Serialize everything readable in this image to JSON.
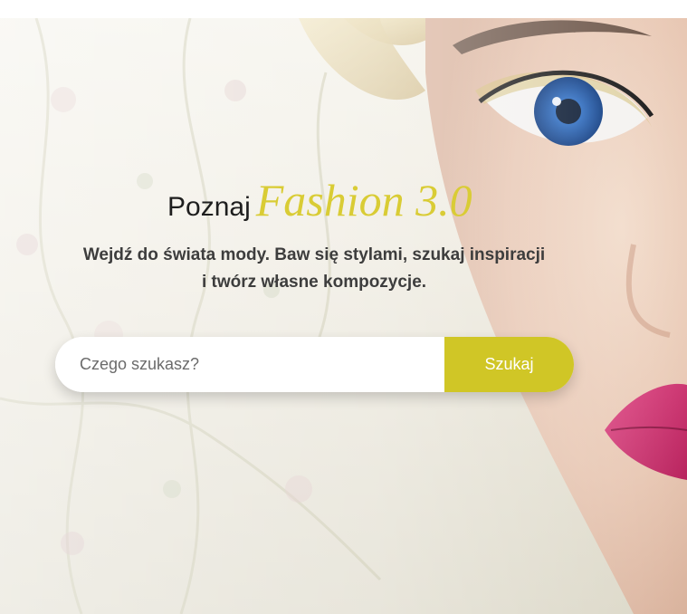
{
  "hero": {
    "headline_plain": "Poznaj",
    "headline_brand": "Fashion 3.0",
    "subtitle_line1": "Wejdź do świata mody. Baw się stylami, szukaj inspiracji",
    "subtitle_line2": "i twórz własne kompozycje."
  },
  "search": {
    "placeholder": "Czego szukasz?",
    "value": "",
    "button_label": "Szukaj"
  },
  "colors": {
    "accent": "#d0c626",
    "brand_text": "#d9cc35",
    "heading_text": "#1e1e1e",
    "subtitle_text": "#3d3d3d"
  }
}
